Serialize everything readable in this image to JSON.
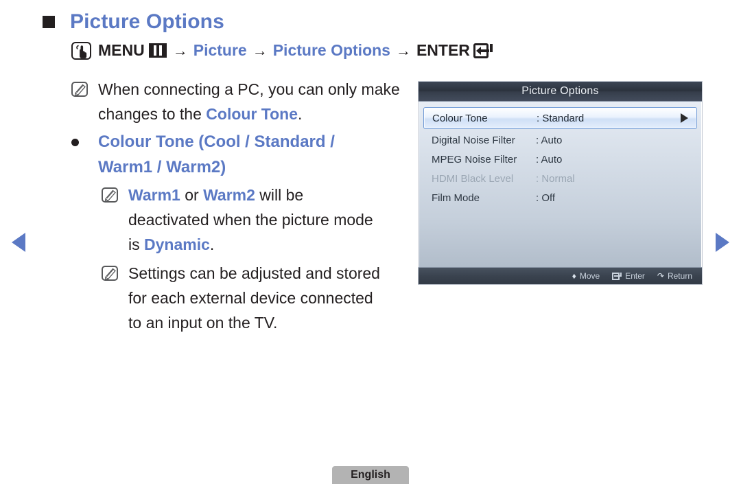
{
  "heading": {
    "bullet_icon": "square-bullet",
    "title": "Picture Options"
  },
  "menu_path": {
    "touch_icon": "hand-touch-icon",
    "menu_label": "MENU",
    "menu_icon": "menu-grid-icon",
    "arrow1": "→",
    "step1": "Picture",
    "arrow2": "→",
    "step2": "Picture Options",
    "arrow3": "→",
    "enter_label": "ENTER",
    "enter_icon": "enter-key-icon"
  },
  "notes": {
    "note1": {
      "icon": "note-pen-icon",
      "text_before": "When connecting a PC, you can only make changes to the ",
      "highlight": "Colour Tone",
      "text_after": "."
    },
    "bullet1": {
      "icon": "round-bullet",
      "text": "Colour Tone (Cool / Standard / Warm1 / Warm2)"
    },
    "note2": {
      "icon": "note-pen-icon",
      "h1": "Warm1",
      "mid1": " or ",
      "h2": "Warm2",
      "mid2": " will be deactivated when the picture mode is ",
      "h3": "Dynamic",
      "tail": "."
    },
    "note3": {
      "icon": "note-pen-icon",
      "text": "Settings can be adjusted and stored for each external device connected to an input on the TV."
    }
  },
  "osd": {
    "title": "Picture Options",
    "rows": [
      {
        "label": "Colour Tone",
        "value": ": Standard",
        "state": "selected",
        "arrow_icon": "right-triangle-icon"
      },
      {
        "label": "Digital Noise Filter",
        "value": ": Auto",
        "state": "normal",
        "arrow_icon": ""
      },
      {
        "label": "MPEG Noise Filter",
        "value": ": Auto",
        "state": "normal",
        "arrow_icon": ""
      },
      {
        "label": "HDMI Black Level",
        "value": ": Normal",
        "state": "disabled",
        "arrow_icon": ""
      },
      {
        "label": "Film Mode",
        "value": ": Off",
        "state": "normal",
        "arrow_icon": ""
      }
    ],
    "footer": {
      "move_icon": "up-down-arrow-icon",
      "move_label": "Move",
      "enter_icon": "enter-key-icon",
      "enter_label": "Enter",
      "return_icon": "return-arrow-icon",
      "return_label": "Return"
    }
  },
  "nav": {
    "prev_icon": "left-triangle-icon",
    "next_icon": "right-triangle-icon"
  },
  "footer": {
    "language": "English"
  },
  "colors": {
    "accent_blue": "#5b79c4",
    "text_dark": "#231f20",
    "osd_header": "#2b323d",
    "osd_selected_border": "#6f9ad6",
    "badge_gray": "#b3b3b3"
  }
}
